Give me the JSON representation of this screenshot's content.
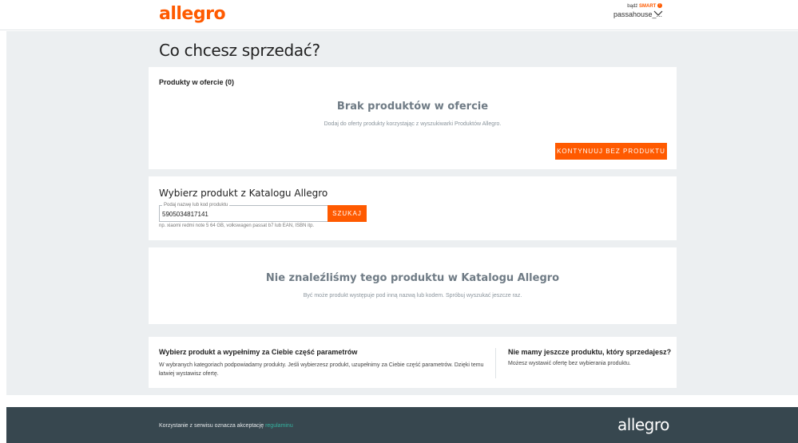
{
  "header": {
    "logo": "allegro",
    "smart_prefix": "bądź",
    "smart_label": "SMART",
    "username": "passahouse_..."
  },
  "page": {
    "title": "Co chcesz sprzedać?"
  },
  "products_card": {
    "heading": "Produkty w ofercie (0)",
    "empty_title": "Brak produktów w ofercie",
    "empty_desc": "Dodaj do oferty produkty korzystając z wyszukiwarki Produktów Allegro.",
    "continue_button": "KONTYNUUJ BEZ PRODUKTU"
  },
  "catalog_card": {
    "heading": "Wybierz produkt z Katalogu Allegro",
    "search_legend": "Podaj nazwę lub kod produktu",
    "search_value": "5905034817141",
    "search_button": "SZUKAJ",
    "hint": "np. xiaomi redmi note 5 64 GB, volkswagen passat b7 lub EAN, ISBN itp."
  },
  "notfound_card": {
    "title": "Nie znaleźliśmy tego produktu w Katalogu Allegro",
    "desc": "Być może produkt występuje pod inną nazwą lub kodem. Spróbuj wyszukać jeszcze raz."
  },
  "info_card": {
    "left_title": "Wybierz produkt a wypełnimy za Ciebie część parametrów",
    "left_desc": "W wybranych kategoriach podpowiadamy produkty. Jeśli wybierzesz produkt, uzupełnimy za Ciebie część parametrów. Dzięki temu łatwiej wystawisz ofertę.",
    "right_title": "Nie mamy jeszcze produktu, który sprzedajesz?",
    "right_desc": "Możesz wystawić ofertę bez wybierania produktu."
  },
  "footer": {
    "text": "Korzystanie z serwisu oznacza akceptację",
    "link": "regulaminu",
    "logo": "allegro"
  },
  "colors": {
    "accent": "#ff5a00",
    "footer_bg": "#37474f",
    "link": "#35b3a0"
  }
}
